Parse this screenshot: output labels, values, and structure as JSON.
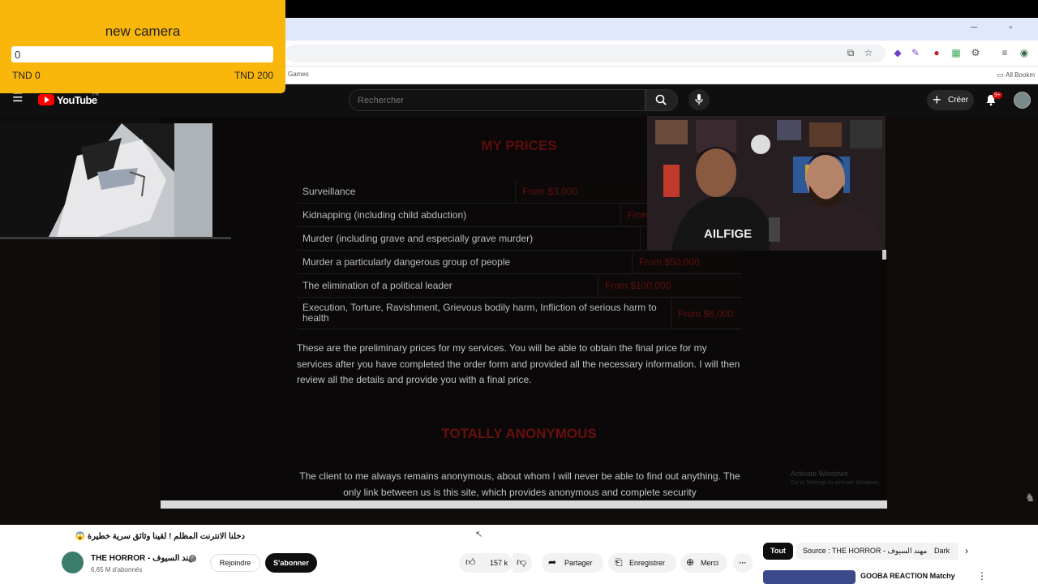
{
  "overlay": {
    "title": "new camera",
    "input_value": "0",
    "min_label": "TND 0",
    "max_label": "TND 200"
  },
  "browser": {
    "window_controls": "─ ▫",
    "bookmark_games": "Games",
    "bookmark_all": "All Bookm"
  },
  "youtube_header": {
    "logo_text": "YouTube",
    "region": "FR",
    "search_placeholder": "Rechercher",
    "create_label": "Créer",
    "notifications": "9+"
  },
  "video_content": {
    "prices_title": "MY PRICES",
    "prices": [
      {
        "service": "Surveillance",
        "price": "From $3,000"
      },
      {
        "service": "Kidnapping (including child abduction)",
        "price": "From"
      },
      {
        "service": "Murder (including grave and especially grave murder)",
        "price": ""
      },
      {
        "service": "Murder a particularly dangerous group of people",
        "price": "From $50,000"
      },
      {
        "service": "The elimination of a political leader",
        "price": "From $100,000"
      },
      {
        "service": "Execution, Torture, Ravishment, Grievous bodily harm, Infliction of serious harm to health",
        "price": "From $6,000"
      }
    ],
    "prices_note": "These are the preliminary prices for my services. You will be able to obtain the final price for my services after you have completed the order form and provided all the necessary information. I will then review all the details and provide you with a final price.",
    "anon_title": "TOTALLY ANONYMOUS",
    "anon_text": "The client to me always remains anonymous, about whom I will never be able to find out anything. The only link between us is this site, which provides anonymous and complete security",
    "activate_windows": "Activate Windows",
    "activate_sub": "Go to Settings to activate Windows."
  },
  "webcam": {
    "shirt_text": "AILFIGE"
  },
  "video_info": {
    "title": "دخلنا الانترنت المظلم ! لقينا وثائق سرية خطيرة 😱",
    "channel_name": "THE HORROR - مهند السيوف",
    "subscribers": "6,65 M d'abonnés",
    "join_label": "Rejoindre",
    "subscribe_label": "S'abonner",
    "likes": "157 k",
    "share_label": "Partager",
    "save_label": "Enregistrer",
    "thanks_label": "Merci",
    "more_label": "···"
  },
  "recommendations": {
    "chips": [
      "Tout",
      "Source : THE HORROR - مهند السيوف",
      "Dark"
    ],
    "first_title": "GOOBA REACTION Matchy"
  },
  "colors": {
    "overlay_bg": "#f9b70c",
    "yt_red": "#ff0000",
    "site_red": "#6a0f0f"
  }
}
